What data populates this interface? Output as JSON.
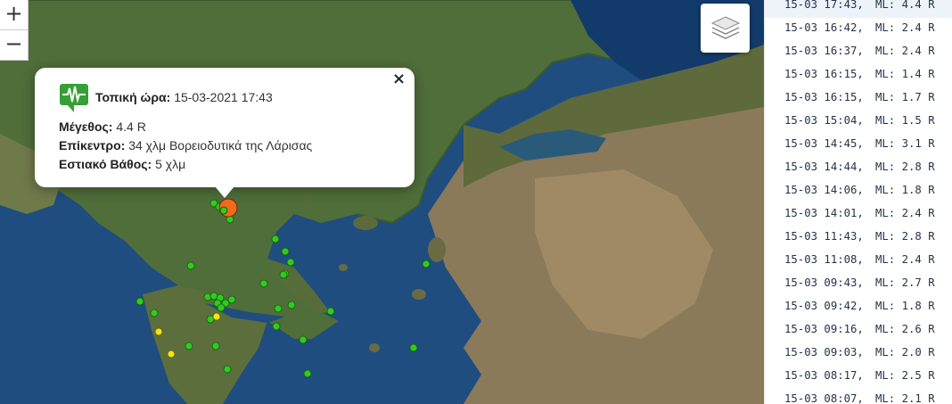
{
  "map": {
    "zoom_in": "+",
    "zoom_out": "−",
    "layers_icon": "layers-icon",
    "popup": {
      "close": "×",
      "icon": "seismograph-icon",
      "time_label": "Τοπική ώρα:",
      "time_value": "15-03-2021 17:43",
      "magnitude_label": "Μέγεθος:",
      "magnitude_value": "4.4 R",
      "epicenter_label": "Επίκεντρο:",
      "epicenter_value": "34 χλμ Βορειοδυτικά της Λάρισας",
      "depth_label": "Εστιακό Βάθος:",
      "depth_value": "5 χλμ"
    },
    "colors": {
      "recent": "#2ecc1e",
      "older": "#f2e21a",
      "selected": "#f26a1b"
    }
  },
  "quakes": [
    {
      "time": "15-03 17:43,",
      "mag": "ML: 4.4 R"
    },
    {
      "time": "15-03 16:42,",
      "mag": "ML: 2.4 R"
    },
    {
      "time": "15-03 16:37,",
      "mag": "ML: 2.4 R"
    },
    {
      "time": "15-03 16:15,",
      "mag": "ML: 1.4 R"
    },
    {
      "time": "15-03 16:15,",
      "mag": "ML: 1.7 R"
    },
    {
      "time": "15-03 15:04,",
      "mag": "ML: 1.5 R"
    },
    {
      "time": "15-03 14:45,",
      "mag": "ML: 3.1 R"
    },
    {
      "time": "15-03 14:44,",
      "mag": "ML: 2.8 R"
    },
    {
      "time": "15-03 14:06,",
      "mag": "ML: 1.8 R"
    },
    {
      "time": "15-03 14:01,",
      "mag": "ML: 2.4 R"
    },
    {
      "time": "15-03 11:43,",
      "mag": "ML: 2.8 R"
    },
    {
      "time": "15-03 11:08,",
      "mag": "ML: 2.4 R"
    },
    {
      "time": "15-03 09:43,",
      "mag": "ML: 2.7 R"
    },
    {
      "time": "15-03 09:42,",
      "mag": "ML: 1.8 R"
    },
    {
      "time": "15-03 09:16,",
      "mag": "ML: 2.6 R"
    },
    {
      "time": "15-03 09:03,",
      "mag": "ML: 2.0 R"
    },
    {
      "time": "15-03 08:17,",
      "mag": "ML: 2.5 R"
    },
    {
      "time": "15-03 08:07,",
      "mag": "ML: 2.1 R"
    }
  ]
}
